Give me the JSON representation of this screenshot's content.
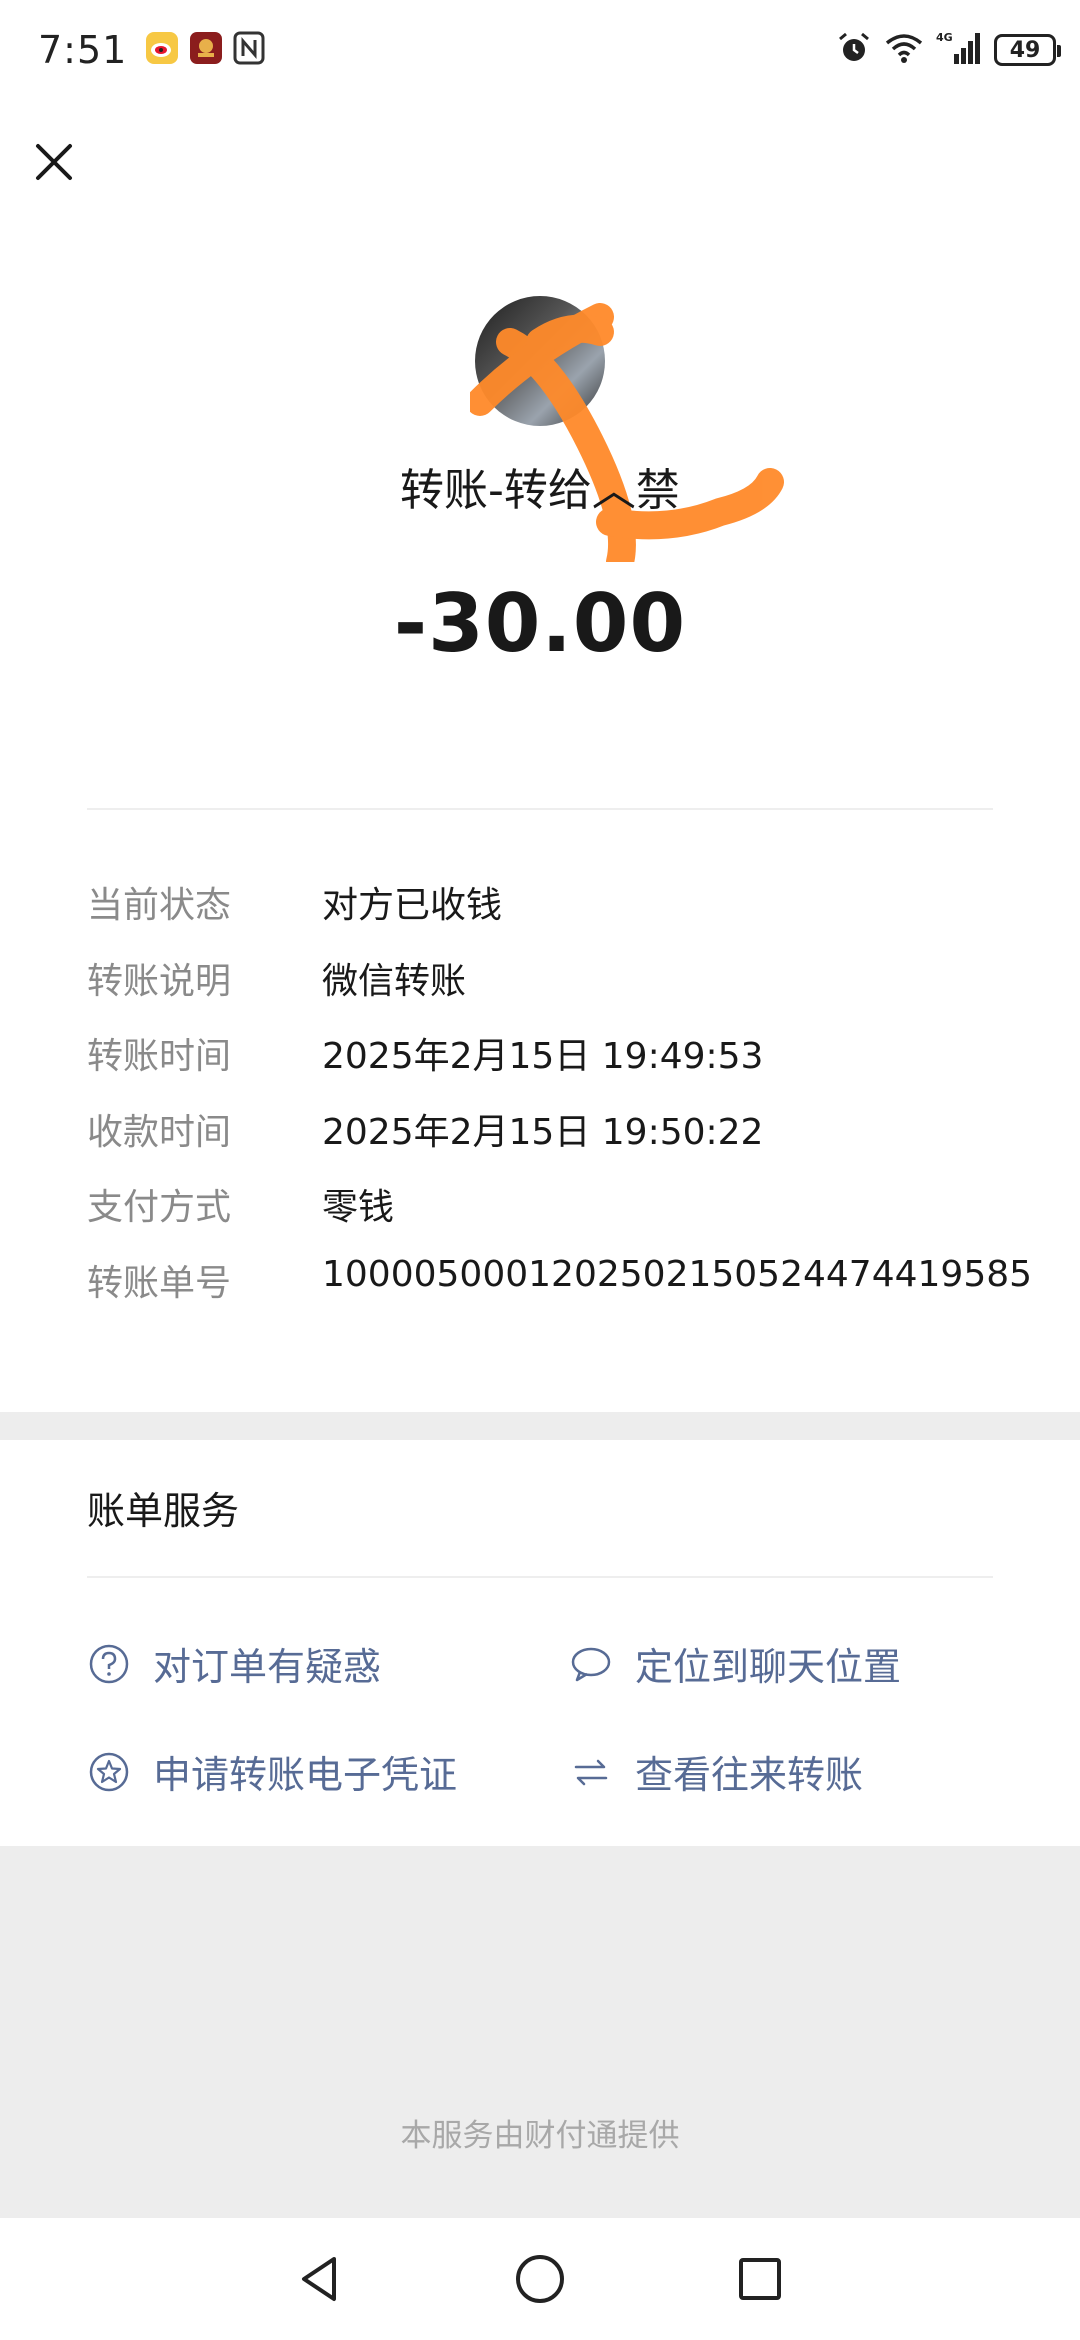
{
  "status_bar": {
    "time": "7:51",
    "battery": "49",
    "network": "4G",
    "icons": [
      "weibo-icon",
      "app-icon",
      "nfc-icon",
      "alarm-icon",
      "wifi-icon",
      "signal-icon",
      "battery-icon"
    ]
  },
  "header": {
    "close_icon": "close-icon"
  },
  "transfer": {
    "title": "转账-转给︿禁",
    "amount": "-30.00"
  },
  "details": [
    {
      "label": "当前状态",
      "value": "对方已收钱"
    },
    {
      "label": "转账说明",
      "value": "微信转账"
    },
    {
      "label": "转账时间",
      "value": "2025年2月15日 19:49:53"
    },
    {
      "label": "收款时间",
      "value": "2025年2月15日 19:50:22"
    },
    {
      "label": "支付方式",
      "value": "零钱"
    },
    {
      "label": "转账单号",
      "value": "1000050001202502150524474419585"
    }
  ],
  "services": {
    "title": "账单服务",
    "items": [
      {
        "label": "对订单有疑惑",
        "icon": "question-circle-icon"
      },
      {
        "label": "定位到聊天位置",
        "icon": "chat-bubble-icon"
      },
      {
        "label": "申请转账电子凭证",
        "icon": "star-circle-icon"
      },
      {
        "label": "查看往来转账",
        "icon": "swap-arrows-icon"
      }
    ]
  },
  "footer": {
    "credit": "本服务由财付通提供"
  },
  "nav": {
    "icons": [
      "back-triangle-icon",
      "home-circle-icon",
      "recents-square-icon"
    ]
  },
  "colors": {
    "link_blue": "#576b95",
    "label_gray": "#8a8a8a",
    "page_bg": "#ededed",
    "scribble": "#ff8a2a"
  }
}
